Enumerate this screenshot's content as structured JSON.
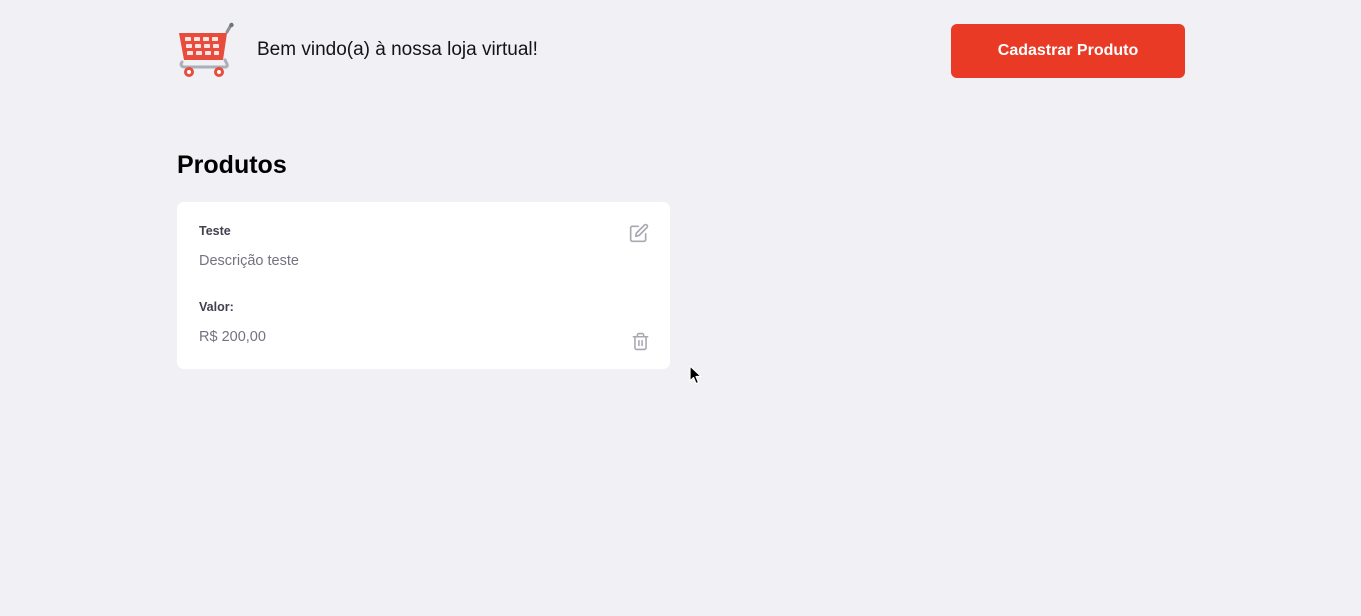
{
  "header": {
    "logo_icon": "shopping-cart-icon",
    "welcome_text": "Bem vindo(a) à nossa loja virtual!",
    "add_button_label": "Cadastrar Produto"
  },
  "main": {
    "title": "Produtos",
    "products": [
      {
        "name_label": "Teste",
        "description": "Descrição teste",
        "price_label": "Valor:",
        "price": "R$ 200,00",
        "edit_icon": "edit-icon",
        "delete_icon": "trash-icon"
      }
    ]
  },
  "colors": {
    "background": "#f0f0f5",
    "accent": "#e83a25",
    "card": "#ffffff",
    "muted_text": "#737380",
    "icon": "#a8a8b3"
  }
}
